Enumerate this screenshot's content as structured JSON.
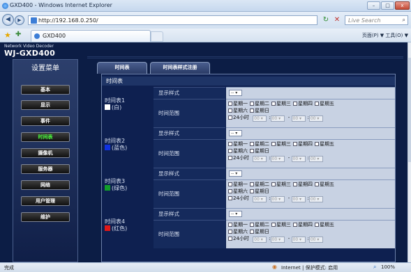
{
  "window": {
    "title": "GXD400 - Windows Internet Explorer",
    "min": "–",
    "max": "□",
    "close": "x"
  },
  "address": {
    "url": "http://192.168.0.250/",
    "search_placeholder": "Live Search"
  },
  "tab": {
    "title": "GXD400"
  },
  "commandbar": {
    "text": "页面(P) ▼  工具(O) ▼"
  },
  "brand": {
    "sub": "Network Video Decoder",
    "main": "WJ-GXD400"
  },
  "sidebar": {
    "title": "设置菜单",
    "items": [
      "基本",
      "显示",
      "事件",
      "时间表",
      "摄像机",
      "服务器",
      "网络",
      "用户管理",
      "维护"
    ],
    "active": "时间表"
  },
  "content": {
    "tabs": [
      "时间表",
      "时间表样式注册"
    ],
    "panel_title": "时间表",
    "label_style": "显示样式",
    "label_range": "时间范围",
    "select_value": "--",
    "days": [
      "星期一",
      "星期二",
      "星期三",
      "星期四",
      "星期五",
      "星期六",
      "星期日"
    ],
    "hours24": "24小时",
    "time_placeholder": "00",
    "schedules": [
      {
        "name": "时间表1",
        "color_name": "(白)",
        "color": "#ffffff"
      },
      {
        "name": "时间表2",
        "color_name": "(蓝色)",
        "color": "#1032e0"
      },
      {
        "name": "时间表3",
        "color_name": "(绿色)",
        "color": "#129e2a"
      },
      {
        "name": "时间表4",
        "color_name": "(红色)",
        "color": "#e01818"
      }
    ]
  },
  "status": {
    "left": "完成",
    "zone": "Internet | 保护模式: 启用",
    "zoom": "100%"
  }
}
